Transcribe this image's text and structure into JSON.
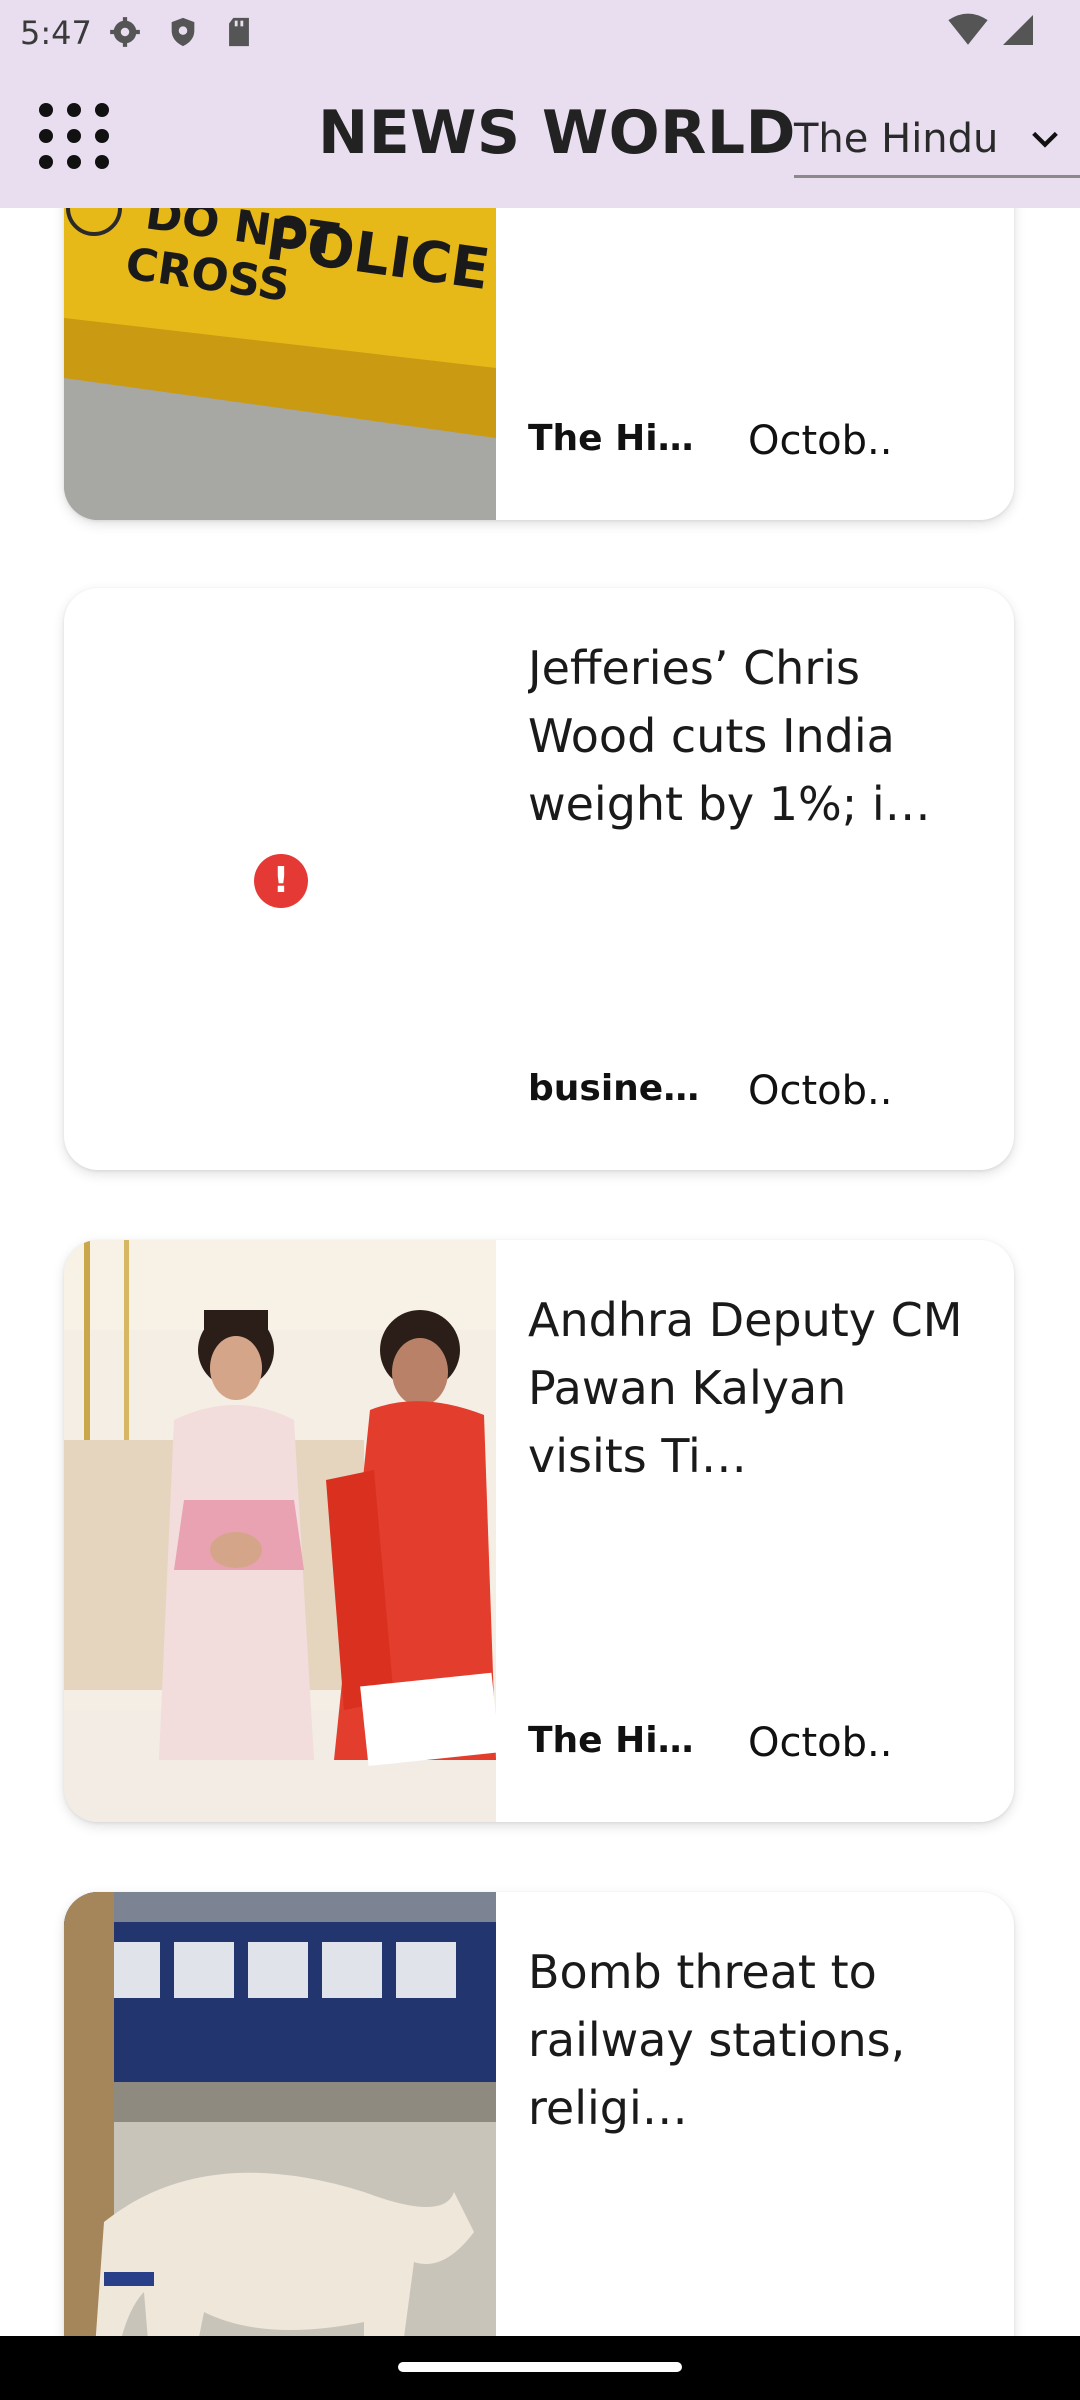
{
  "status_bar": {
    "time": "5:47",
    "icons": [
      "settings-icon",
      "shield-icon",
      "sd-card-icon",
      "wifi-icon",
      "signal-icon"
    ]
  },
  "app_bar": {
    "title": "NEWS WORLD",
    "menu_icon": "grid-menu-icon",
    "source_selector": {
      "value": "The Hindu",
      "icon": "chevron-down-icon"
    }
  },
  "articles": [
    {
      "headline": "",
      "source": "The Hin…",
      "date": "Octob..",
      "image": "police-tape-photo"
    },
    {
      "headline": "Jefferies’ Chris Wood cuts India weight by 1%; i…",
      "source": "busines…",
      "date": "Octob..",
      "image": "image-load-error",
      "error_icon_text": "!"
    },
    {
      "headline": "Andhra Deputy CM Pawan Kalyan visits Ti…",
      "source": "The Hin…",
      "date": "Octob..",
      "image": "temple-visit-photo"
    },
    {
      "headline": "Bomb threat to railway stations, religi…",
      "source": "",
      "date": "",
      "image": "sniffer-dog-photo"
    }
  ],
  "colors": {
    "app_bar_bg": "#e8deef",
    "error_red": "#e53935",
    "nav_bar_bg": "#000000"
  }
}
